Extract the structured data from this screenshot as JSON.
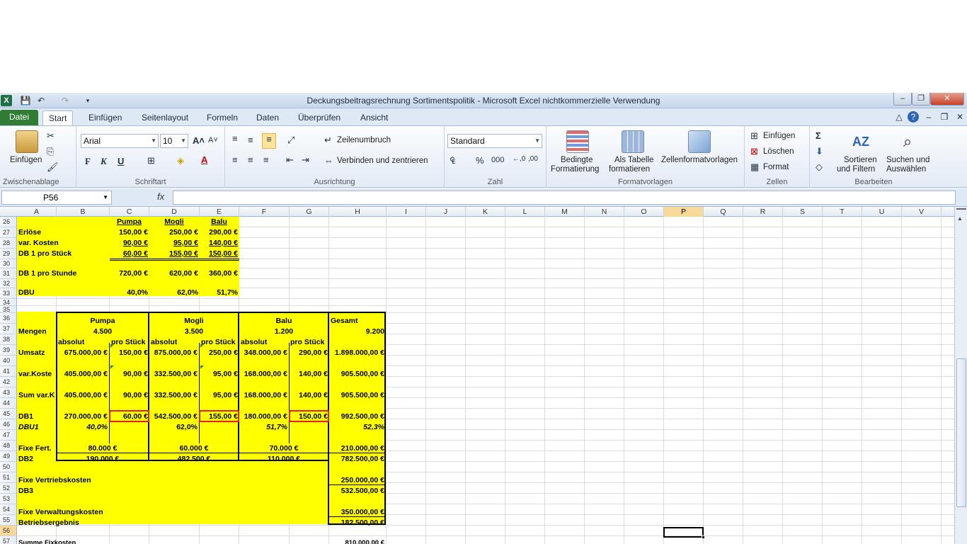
{
  "window": {
    "title": "Deckungsbeitragsrechnung Sortimentspolitik  -  Microsoft Excel nichtkommerzielle Verwendung"
  },
  "tabs": [
    "Datei",
    "Start",
    "Einfügen",
    "Seitenlayout",
    "Formeln",
    "Daten",
    "Überprüfen",
    "Ansicht"
  ],
  "ribbon": {
    "paste": "Einfügen",
    "clipboard": "Zwischenablage",
    "font_name": "Arial",
    "font_size": "10",
    "font_group": "Schriftart",
    "bold": "F",
    "italic": "K",
    "underline": "U",
    "wrap": "Zeilenumbruch",
    "merge": "Verbinden und zentrieren",
    "align_group": "Ausrichtung",
    "number_format": "Standard",
    "number_group": "Zahl",
    "percent": "%",
    "thousands": "000",
    "cond_format_1": "Bedingte",
    "cond_format_2": "Formatierung",
    "as_table_1": "Als Tabelle",
    "as_table_2": "formatieren",
    "cell_styles": "Zellenformatvorlagen",
    "styles_group": "Formatvorlagen",
    "insert": "Einfügen",
    "delete": "Löschen",
    "format": "Format",
    "cells_group": "Zellen",
    "sort_1": "Sortieren",
    "sort_2": "und Filtern",
    "find_1": "Suchen und",
    "find_2": "Auswählen",
    "edit_group": "Bearbeiten",
    "sigma": "Σ"
  },
  "formula_bar": {
    "name_box": "P56",
    "fx": "fx",
    "value": ""
  },
  "columns": [
    "A",
    "B",
    "C",
    "D",
    "E",
    "F",
    "G",
    "H",
    "I",
    "J",
    "K",
    "L",
    "M",
    "N",
    "O",
    "P",
    "Q",
    "R",
    "S",
    "T",
    "U",
    "V"
  ],
  "rows": [
    "26",
    "27",
    "28",
    "29",
    "30",
    "31",
    "32",
    "33",
    "34",
    "35",
    "36",
    "37",
    "38",
    "39",
    "40",
    "41",
    "42",
    "43",
    "44",
    "45",
    "46",
    "47",
    "48",
    "49",
    "50",
    "51",
    "52",
    "53",
    "54",
    "55",
    "56",
    "57"
  ],
  "cells": {
    "c26": "Pumpa",
    "d26": "Mogli",
    "e26": "Balu",
    "a27": "Erlöse",
    "c27": "150,00 €",
    "d27": "250,00 €",
    "e27": "290,00 €",
    "a28": "var. Kosten",
    "c28": "90,00 €",
    "d28": "95,00 €",
    "e28": "140,00 €",
    "a29": "DB 1 pro Stück",
    "c29": "60,00 €",
    "d29": "155,00 €",
    "e29": "150,00 €",
    "a31": "DB 1 pro Stunde",
    "c31": "720,00 €",
    "d31": "620,00 €",
    "e31": "360,00 €",
    "a33": "DBU",
    "c33": "40,0%",
    "d33": "62,0%",
    "e33": "51,7%",
    "bc36": "Pumpa",
    "de36": "Mogli",
    "fg36": "Balu",
    "h36": "Gesamt",
    "a37": "Mengen",
    "bc37": "4.500",
    "de37": "3.500",
    "fg37": "1.200",
    "h37": "9.200",
    "b38": "absolut",
    "c38": "pro Stück",
    "d38": "absolut",
    "e38": "pro Stück",
    "f38": "absolut",
    "g38": "pro Stück",
    "a39": "Umsatz",
    "b39": "675.000,00 €",
    "c39": "150,00 €",
    "d39": "875.000,00 €",
    "e39": "250,00 €",
    "f39": "348.000,00 €",
    "g39": "290,00 €",
    "h39": "1.898.000,00 €",
    "a41": "var.Koste",
    "b41": "405.000,00 €",
    "c41": "90,00 €",
    "d41": "332.500,00 €",
    "e41": "95,00 €",
    "f41": "168.000,00 €",
    "g41": "140,00 €",
    "h41": "905.500,00 €",
    "a43": "Sum var.K",
    "b43": "405.000,00 €",
    "c43": "90,00 €",
    "d43": "332.500,00 €",
    "e43": "95,00 €",
    "f43": "168.000,00 €",
    "g43": "140,00 €",
    "h43": "905.500,00 €",
    "a45": "DB1",
    "b45": "270.000,00 €",
    "c45": "60,00 €",
    "d45": "542.500,00 €",
    "e45": "155,00 €",
    "f45": "180.000,00 €",
    "g45": "150,00 €",
    "h45": "992.500,00 €",
    "a46": "DBU1",
    "b46": "40,0%",
    "d46": "62,0%",
    "f46": "51,7%",
    "h46": "52,3%",
    "a48": "Fixe Fert.",
    "bc48": "80.000 €",
    "de48": "60.000 €",
    "fg48": "70.000 €",
    "h48": "210.000,00 €",
    "a49": "DB2",
    "bc49": "190.000 €",
    "de49": "482.500 €",
    "fg49": "110.000 €",
    "h49": "782.500,00 €",
    "a51": "Fixe Vertriebskosten",
    "h51": "250.000,00 €",
    "a52": "DB3",
    "h52": "532.500,00 €",
    "a54": "Fixe Verwaltungskosten",
    "h54": "350.000,00 €",
    "a55": "Betriebsergebnis",
    "h55": "182.500,00 €",
    "a57": "Summe Fixkosten",
    "h57": "810.000,00 €"
  },
  "colors": {
    "highlight": "#ffff00",
    "excel_green": "#1e7145",
    "selection_header": "#f9d99a",
    "error_box": "#e0201a"
  }
}
